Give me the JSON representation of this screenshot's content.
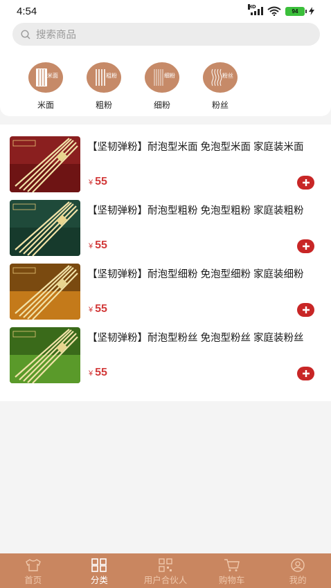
{
  "status_bar": {
    "time": "4:54",
    "hd_label": "HD",
    "battery": "94",
    "icons": [
      "signal-icon",
      "wifi-icon",
      "battery-icon",
      "charging-icon"
    ]
  },
  "search": {
    "placeholder": "搜索商品",
    "icon": "search-icon"
  },
  "categories": [
    {
      "label": "米面",
      "badge": "米面",
      "icon": "noodle-bundle-icon"
    },
    {
      "label": "粗粉",
      "badge": "粗粉",
      "icon": "thick-noodle-icon"
    },
    {
      "label": "细粉",
      "badge": "细粉",
      "icon": "thin-noodle-icon"
    },
    {
      "label": "粉丝",
      "badge": "粉丝",
      "icon": "vermicelli-icon"
    }
  ],
  "products": [
    {
      "title": "【坚韧弹粉】耐泡型米面 免泡型米面 家庭装米面",
      "currency": "¥",
      "price": "55",
      "image_bg": "#8a1f1f",
      "add_icon": "plus-circle-icon"
    },
    {
      "title": "【坚韧弹粉】耐泡型粗粉 免泡型粗粉 家庭装粗粉",
      "currency": "¥",
      "price": "55",
      "image_bg": "#1f4a3a",
      "add_icon": "plus-circle-icon"
    },
    {
      "title": "【坚韧弹粉】耐泡型细粉 免泡型细粉 家庭装细粉",
      "currency": "¥",
      "price": "55",
      "image_bg": "#7a4a10",
      "add_icon": "plus-circle-icon"
    },
    {
      "title": "【坚韧弹粉】耐泡型粉丝 免泡型粉丝 家庭装粉丝",
      "currency": "¥",
      "price": "55",
      "image_bg": "#3a6a1a",
      "add_icon": "plus-circle-icon"
    }
  ],
  "tabbar": {
    "active_index": 1,
    "items": [
      {
        "label": "首页",
        "icon": "shirt-home-icon"
      },
      {
        "label": "分类",
        "icon": "category-grid-icon"
      },
      {
        "label": "用户合伙人",
        "icon": "qr-code-icon"
      },
      {
        "label": "购物车",
        "icon": "cart-icon"
      },
      {
        "label": "我的",
        "icon": "user-icon"
      }
    ]
  },
  "colors": {
    "accent": "#c98660",
    "category_circle": "#c68a68",
    "price": "#d23a3a",
    "add_button": "#c82626"
  }
}
